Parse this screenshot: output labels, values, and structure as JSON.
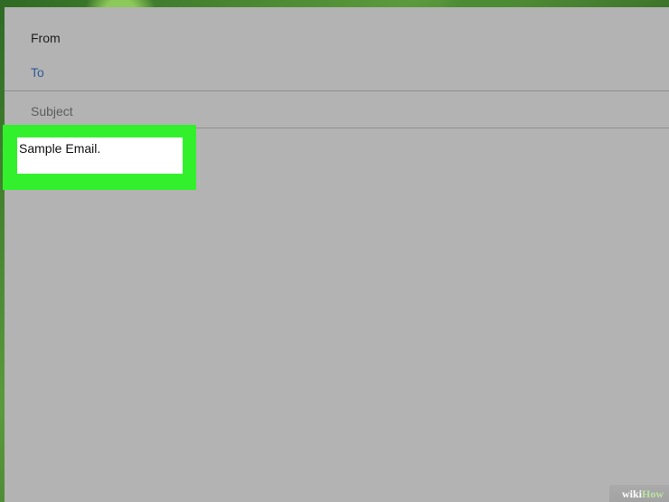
{
  "compose": {
    "from_label": "From",
    "to_label": "To",
    "subject_label": "Subject",
    "body_text": "Sample Email."
  },
  "watermark": {
    "wiki": "wiki",
    "how": "How"
  },
  "colors": {
    "window_bg": "#b3b3b3",
    "to_label": "#2f5a9a",
    "highlight": "#33f02d",
    "body_box": "#ffffff"
  }
}
